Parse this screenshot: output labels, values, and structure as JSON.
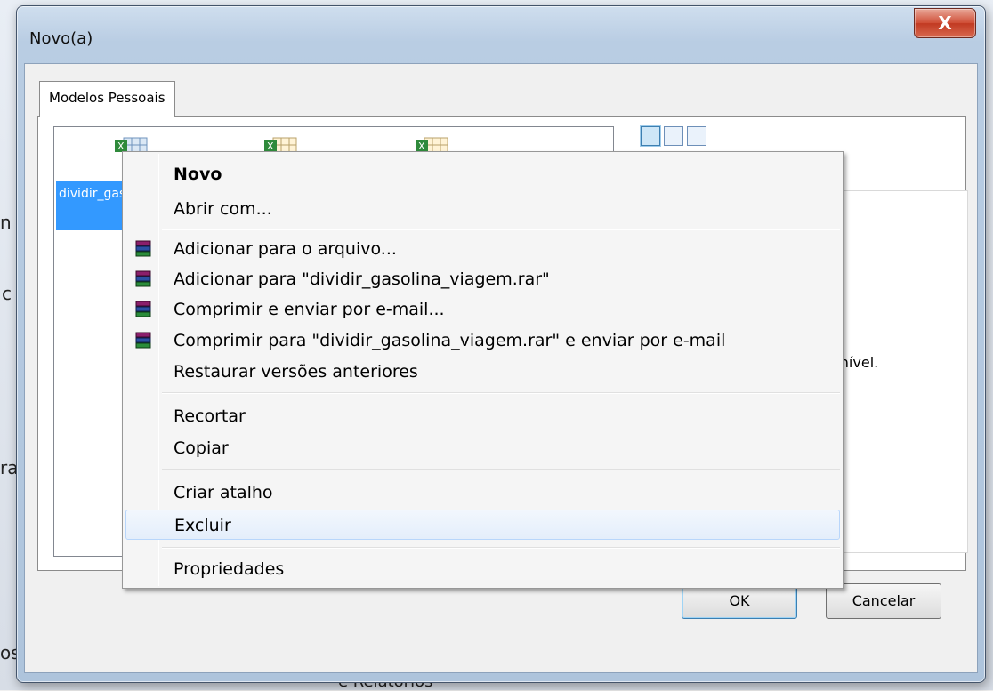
{
  "dialog": {
    "title": "Novo(a)",
    "close_label": "X"
  },
  "tab": {
    "label": "Modelos Pessoais"
  },
  "file_list": {
    "selected_label": "dividir_gasolina_viagem"
  },
  "preview": {
    "message_fragment": "onível."
  },
  "buttons": {
    "ok": "OK",
    "cancel": "Cancelar"
  },
  "context_menu": {
    "items": [
      {
        "label": "Novo",
        "bold": true,
        "icon": ""
      },
      {
        "label": "Abrir com...",
        "icon": ""
      },
      {
        "label": "Adicionar para o arquivo...",
        "icon": "winrar-icon"
      },
      {
        "label": "Adicionar para \"dividir_gasolina_viagem.rar\"",
        "icon": "winrar-icon"
      },
      {
        "label": "Comprimir e enviar por e-mail...",
        "icon": "winrar-icon"
      },
      {
        "label": "Comprimir para \"dividir_gasolina_viagem.rar\" e enviar por e-mail",
        "icon": "winrar-icon"
      },
      {
        "label": "Restaurar versões anteriores",
        "icon": ""
      },
      {
        "label": "Recortar",
        "icon": ""
      },
      {
        "label": "Copiar",
        "icon": ""
      },
      {
        "label": "Criar atalho",
        "icon": ""
      },
      {
        "label": "Excluir",
        "icon": "",
        "hover": true
      },
      {
        "label": "Propriedades",
        "icon": ""
      }
    ]
  },
  "background": {
    "fragment_bottom": "e Relatórios"
  }
}
